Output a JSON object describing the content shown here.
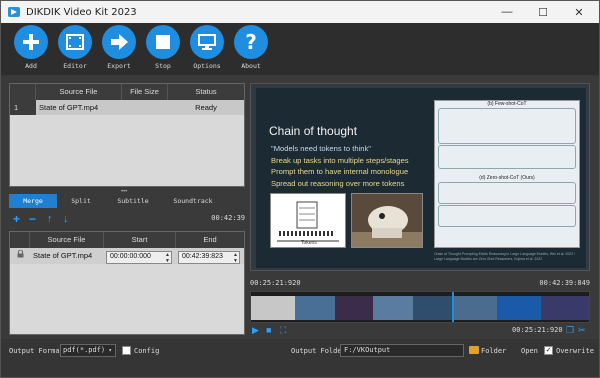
{
  "window": {
    "title": "DIKDIK Video Kit 2023",
    "minimize": "—",
    "maximize": "☐",
    "close": "✕"
  },
  "toolbar": {
    "add": "Add",
    "editor": "Editor",
    "export": "Export",
    "stop": "Stop",
    "options": "Options",
    "about": "About"
  },
  "files": {
    "columns": [
      "",
      "Source File",
      "File Size",
      "Status"
    ],
    "rows": [
      {
        "index": "1",
        "source": "State of GPT.mp4",
        "size": "",
        "status": "Ready"
      }
    ]
  },
  "tabs": [
    "Merge",
    "Split",
    "Subtitle",
    "Soundtrack"
  ],
  "segments": {
    "duration": "00:42:39",
    "columns": [
      "",
      "Source File",
      "Start",
      "End"
    ],
    "rows": [
      {
        "source": "State of GPT.mp4",
        "start": "00:00:00:000",
        "end": "00:42:39:823"
      }
    ]
  },
  "preview": {
    "slide_title": "Chain of thought",
    "bullets": [
      "\"Models need tokens to think\"",
      "Break up tasks into multiple steps/stages",
      "Prompt them to have internal monologue",
      "Spread out reasoning over more tokens"
    ],
    "paper_title_a": "(b) Few-shot-CoT",
    "paper_title_b": "(d) Zero-shot-CoT (Ours)",
    "chart_axis_label": "Tokens",
    "caption": "Chain of Thought Prompting Elicits Reasoning in Large Language Models, Wei et al. 2022 / Large Language Models are Zero-Shot Reasoners, Kojima et al. 2022"
  },
  "timeline": {
    "current": "00:25:21:920",
    "total": "00:42:39:849",
    "position": "00:25:21:920",
    "progress": 0.594
  },
  "bottom": {
    "format_label": "Output Format",
    "format_value": "pdf(*.pdf)",
    "config_label": "Config",
    "folder_label": "Output Folder",
    "folder_value": "F:/VKOutput",
    "folder_button": "Folder",
    "open_button": "Open",
    "overwrite_label": "Overwrite"
  },
  "colors": {
    "accent": "#1f8de0",
    "toolbar_bg": "#2d2d2d",
    "slide_bg": "#1c2a33"
  }
}
